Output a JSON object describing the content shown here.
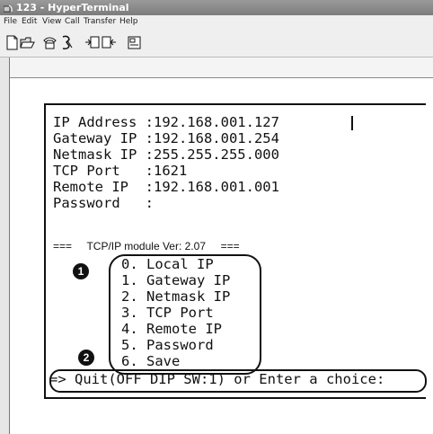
{
  "window": {
    "title": "123 - HyperTerminal"
  },
  "menu": [
    "File",
    "Edit",
    "View",
    "Call",
    "Transfer",
    "Help"
  ],
  "terminal": {
    "settings": [
      "IP Address :192.168.001.127",
      "Gateway IP :192.168.001.254",
      "Netmask IP :255.255.255.000",
      "TCP Port   :1621",
      "Remote IP  :192.168.001.001",
      "Password   :"
    ],
    "version_line": "===     TCP/IP module Ver: 2.07     ===",
    "options": [
      "0. Local IP",
      "1. Gateway IP",
      "2. Netmask IP",
      "3. TCP Port",
      "4. Remote IP",
      "5. Password",
      "6. Save"
    ],
    "prompt": "=> Quit(OFF DIP SW:1) or Enter a choice:"
  },
  "callouts": [
    "1",
    "2"
  ]
}
